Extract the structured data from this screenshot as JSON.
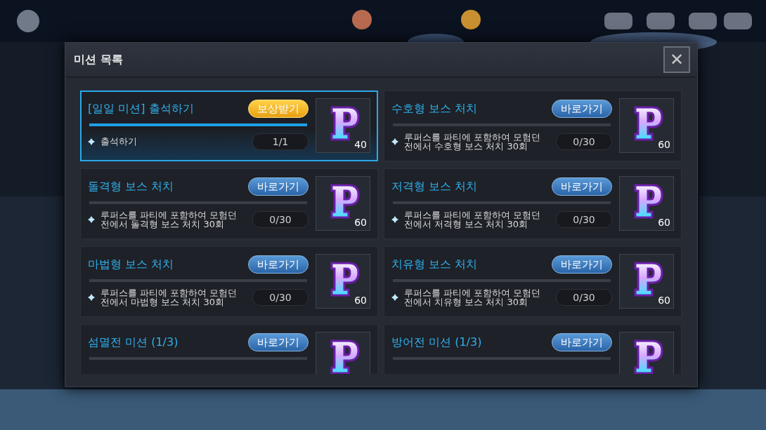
{
  "dialog": {
    "title": "미션 목록",
    "close": "✕"
  },
  "missions": [
    {
      "title": "[일일 미션] 출석하기",
      "button": {
        "kind": "claim",
        "label": "보상받기"
      },
      "level": 1,
      "selected": true,
      "description": "출석하기",
      "progress": "1/1",
      "reward": "40"
    },
    {
      "title": "수호형 보스 처치",
      "button": {
        "kind": "go",
        "label": "바로가기"
      },
      "level": 0,
      "selected": false,
      "description": "루퍼스를 파티에 포함하여 모험던전에서 수호형 보스 처치 30회",
      "progress": "0/30",
      "reward": "60"
    },
    {
      "title": "돌격형 보스 처치",
      "button": {
        "kind": "go",
        "label": "바로가기"
      },
      "level": 0,
      "selected": false,
      "description": "루퍼스를 파티에 포함하여 모험던전에서 돌격형 보스 처치 30회",
      "progress": "0/30",
      "reward": "60"
    },
    {
      "title": "저격형 보스 처치",
      "button": {
        "kind": "go",
        "label": "바로가기"
      },
      "level": 0,
      "selected": false,
      "description": "루퍼스를 파티에 포함하여 모험던전에서 저격형 보스 처치 30회",
      "progress": "0/30",
      "reward": "60"
    },
    {
      "title": "마법형 보스 처치",
      "button": {
        "kind": "go",
        "label": "바로가기"
      },
      "level": 0,
      "selected": false,
      "description": "루퍼스를 파티에 포함하여 모험던전에서 마법형 보스 처치 30회",
      "progress": "0/30",
      "reward": "60"
    },
    {
      "title": "치유형 보스 처치",
      "button": {
        "kind": "go",
        "label": "바로가기"
      },
      "level": 0,
      "selected": false,
      "description": "루퍼스를 파티에 포함하여 모험던전에서 치유형 보스 처치 30회",
      "progress": "0/30",
      "reward": "60"
    },
    {
      "title": "섬멸전 미션 (1/3)",
      "button": {
        "kind": "go",
        "label": "바로가기"
      },
      "level": 0,
      "selected": false
    },
    {
      "title": "방어전 미션 (1/3)",
      "button": {
        "kind": "go",
        "label": "바로가기"
      },
      "level": 0,
      "selected": false
    }
  ]
}
